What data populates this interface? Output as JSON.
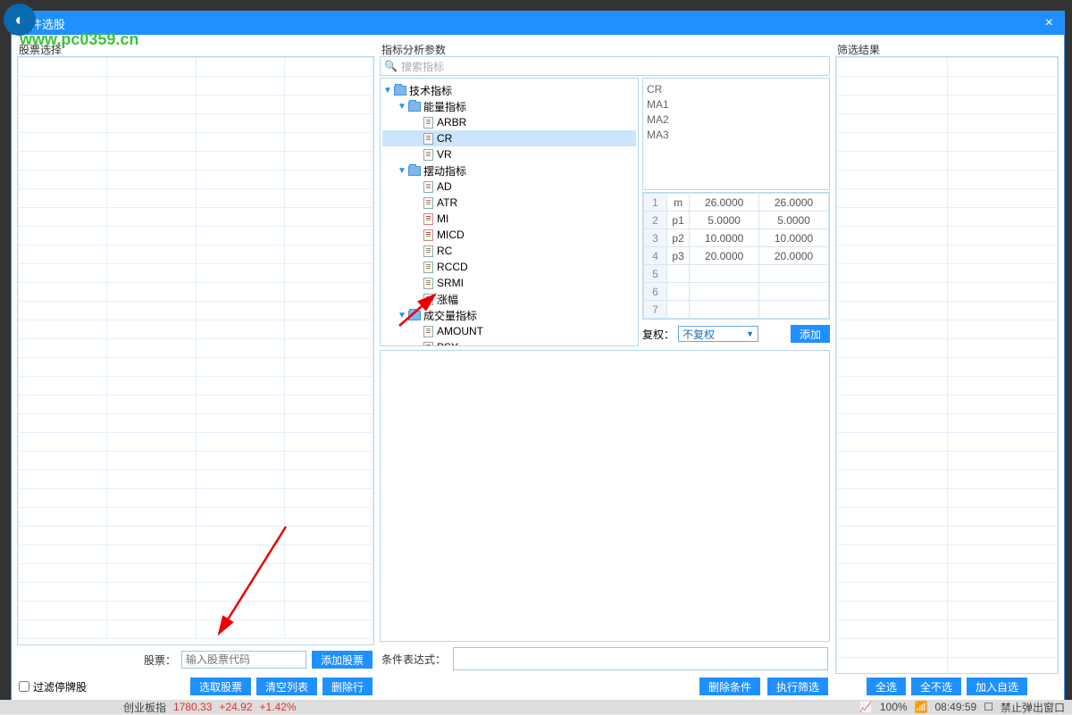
{
  "window": {
    "title": "条件选股"
  },
  "watermark": "www.pc0359.cn",
  "panels": {
    "left": "股票选择",
    "mid": "指标分析参数",
    "right": "筛选结果"
  },
  "stock": {
    "label": "股票：",
    "placeholder": "输入股票代码",
    "add": "添加股票"
  },
  "left": {
    "filter": "过滤停牌股",
    "select": "选取股票",
    "clear": "清空列表",
    "delrow": "删除行"
  },
  "search": {
    "placeholder": "搜索指标"
  },
  "tree": {
    "root": "技术指标",
    "cat1": "能量指标",
    "c1": [
      "ARBR",
      "CR",
      "VR"
    ],
    "cat2": "摆动指标",
    "c2": [
      "AD",
      "ATR",
      "MI",
      "MICD",
      "RC",
      "RCCD",
      "SRMI",
      "涨幅"
    ],
    "cat3": "成交量指标",
    "c3": [
      "AMOUNT",
      "PSY"
    ]
  },
  "list": [
    "CR",
    "MA1",
    "MA2",
    "MA3"
  ],
  "params": {
    "rows": [
      {
        "n": "1",
        "k": "m",
        "a": "26.0000",
        "b": "26.0000"
      },
      {
        "n": "2",
        "k": "p1",
        "a": "5.0000",
        "b": "5.0000"
      },
      {
        "n": "3",
        "k": "p2",
        "a": "10.0000",
        "b": "10.0000"
      },
      {
        "n": "4",
        "k": "p3",
        "a": "20.0000",
        "b": "20.0000"
      },
      {
        "n": "5",
        "k": "",
        "a": "",
        "b": ""
      },
      {
        "n": "6",
        "k": "",
        "a": "",
        "b": ""
      },
      {
        "n": "7",
        "k": "",
        "a": "",
        "b": ""
      }
    ]
  },
  "fuquan": {
    "label": "复权：",
    "value": "不复权",
    "add": "添加"
  },
  "expr": {
    "label": "条件表达式："
  },
  "mid_btn": {
    "del": "删除条件",
    "run": "执行筛选"
  },
  "right_btn": {
    "all": "全选",
    "none": "全不选",
    "fav": "加入自选"
  },
  "status": {
    "idx": "创业板指",
    "v1": "1780.33",
    "v2": "+24.92",
    "v3": "+1.42%",
    "zoom": "100%",
    "time": "08:49:59",
    "chk": "禁止弹出窗口"
  }
}
